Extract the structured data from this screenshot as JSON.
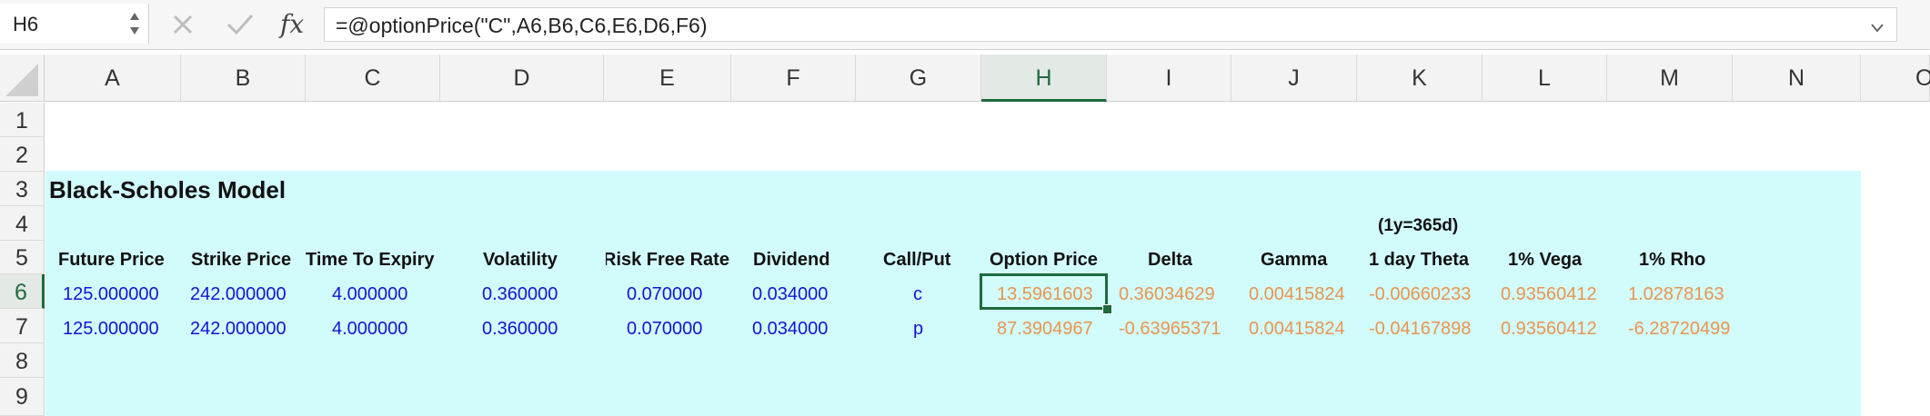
{
  "formula_bar": {
    "name_box": "H6",
    "fx_label": "fx",
    "formula": "=@optionPrice(\"C\",A6,B6,C6,E6,D6,F6)"
  },
  "columns": [
    "A",
    "B",
    "C",
    "D",
    "E",
    "F",
    "G",
    "H",
    "I",
    "J",
    "K",
    "L",
    "M",
    "N",
    "O"
  ],
  "rows": [
    "1",
    "2",
    "3",
    "4",
    "5",
    "6",
    "7",
    "8",
    "9"
  ],
  "sheet": {
    "title": "Black-Scholes Model",
    "theta_note": "(1y=365d)",
    "headers": [
      "Future Price",
      "Strike Price",
      "Time To Expiry",
      "Volatility",
      "Risk Free Rate",
      "Dividend",
      "Call/Put",
      "Option Price",
      "Delta",
      "Gamma",
      "1 day Theta",
      "1% Vega",
      "1% Rho"
    ],
    "data_rows": [
      [
        "125.000000",
        "242.000000",
        "4.000000",
        "0.360000",
        "0.070000",
        "0.034000",
        "c",
        "13.5961603",
        "0.36034629",
        "0.00415824",
        "-0.00660233",
        "0.93560412",
        "1.02878163"
      ],
      [
        "125.000000",
        "242.000000",
        "4.000000",
        "0.360000",
        "0.070000",
        "0.034000",
        "p",
        "87.3904967",
        "-0.63965371",
        "0.00415824",
        "-0.04167898",
        "0.93560412",
        "-6.28720499"
      ]
    ]
  },
  "colors": {
    "band": "#d2fbfc",
    "input_text": "#1414d2",
    "output_text": "#e9954f",
    "selection": "#1e6b3d"
  }
}
